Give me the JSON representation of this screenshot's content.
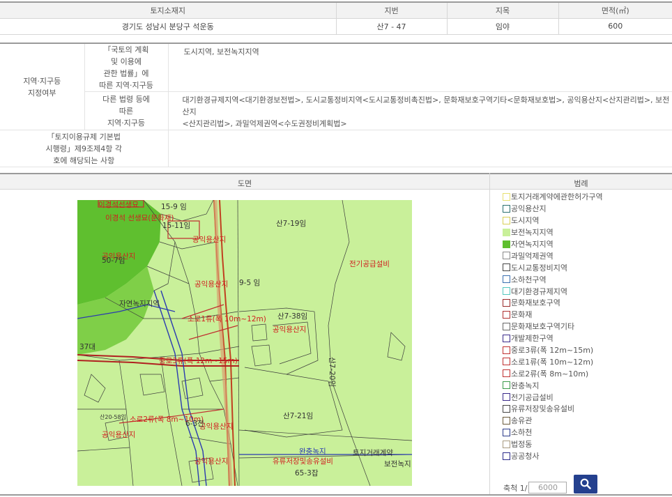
{
  "land_info": {
    "headers": [
      "토지소재지",
      "지번",
      "지목",
      "면적(㎡)"
    ],
    "location": "경기도 성남시 분당구 석운동",
    "lot_number": "산7 - 47",
    "land_category": "임야",
    "area": "600"
  },
  "zoning": {
    "main_label_1": "지역·지구등",
    "main_label_2": "지정여부",
    "national_label": [
      "「국토의 계획",
      "및 이용에",
      "관한 법률」에",
      "따른 지역·지구등"
    ],
    "national_value": "도시지역, 보전녹지지역",
    "other_label": [
      "다른 법령 등에",
      "따른",
      "지역·지구등"
    ],
    "other_value_1": "대기환경규제지역<대기환경보전법>, 도시교통정비지역<도시교통정비촉진법>, 문화재보호구역기타<문화재보호법>, 공익용산지<산지관리법>, 보전산지",
    "other_value_2": "<산지관리법>, 과밀억제권역<수도권정비계획법>",
    "enforcement_label": [
      "「토지이용규제 기본법",
      "시행령」제9조제4항 각",
      "호에 해당되는 사항"
    ],
    "enforcement_value": ""
  },
  "map_section": {
    "map_header": "도면",
    "legend_header": "범례",
    "labels": {
      "l1": "이경석선생묘",
      "l2": "15-9 임",
      "l3": "이경석 선생묘(문화재)",
      "l4": "15-11임",
      "l5": "산7-19임",
      "l6": "공익용산지",
      "l7": "공익용산지",
      "l8": "50-7임",
      "l9": "전기공급설비",
      "l10": "공익용산지",
      "l11": "9-5 임",
      "l12": "자연녹지지역",
      "l13": "소로1류(폭 10m~12m)",
      "l14": "산7-38임",
      "l15": "공익용산지",
      "l16": "산7-20임",
      "l17": "중로3류(폭 12m~15m)",
      "l18": "37대",
      "l19": "소로2류(폭 8m~10m)",
      "l20": "공익용산지",
      "l21": "공익용산지",
      "l22": "산7-21임",
      "l23": "완충녹지",
      "l24": "토지거래계약",
      "l25": "공익용산지",
      "l26": "유류저장및송유설비",
      "l27": "65-3잡",
      "l28": "보전녹지",
      "l29": "6-3전",
      "l30": "산20-58임"
    }
  },
  "legend": [
    {
      "label": "토지거래계약에관한허가구역",
      "fill": "#ffffff",
      "border": "#e8e070"
    },
    {
      "label": "공익용산지",
      "fill": "#ffffff",
      "border": "#2b6f6f"
    },
    {
      "label": "도시지역",
      "fill": "#ffffff",
      "border": "#d9cf55"
    },
    {
      "label": "보전녹지지역",
      "fill": "#c9f09a",
      "border": "#c9f09a"
    },
    {
      "label": "자연녹지지역",
      "fill": "#5fbf2f",
      "border": "#5fbf2f"
    },
    {
      "label": "과밀억제권역",
      "fill": "#ffffff",
      "border": "#8a8a8a"
    },
    {
      "label": "도시교통정비지역",
      "fill": "#ffffff",
      "border": "#444444"
    },
    {
      "label": "소하천구역",
      "fill": "#ffffff",
      "border": "#3a6fb0"
    },
    {
      "label": "대기환경규제지역",
      "fill": "#ffffff",
      "border": "#55c8c0"
    },
    {
      "label": "문화재보호구역",
      "fill": "#ffffff",
      "border": "#9a2a2a"
    },
    {
      "label": "문화재",
      "fill": "#ffffff",
      "border": "#b03030"
    },
    {
      "label": "문화재보호구역기타",
      "fill": "#ffffff",
      "border": "#666666"
    },
    {
      "label": "개발제한구역",
      "fill": "#ffffff",
      "border": "#3a2a8a"
    },
    {
      "label": "중로3류(폭 12m~15m)",
      "fill": "#ffffff",
      "border": "#c03030"
    },
    {
      "label": "소로1류(폭 10m~12m)",
      "fill": "#ffffff",
      "border": "#c03030"
    },
    {
      "label": "소로2류(폭 8m~10m)",
      "fill": "#ffffff",
      "border": "#c03030"
    },
    {
      "label": "완충녹지",
      "fill": "#ffffff",
      "border": "#3a9a4a"
    },
    {
      "label": "전기공급설비",
      "fill": "#ffffff",
      "border": "#3a2a8a"
    },
    {
      "label": "유류저장및송유설비",
      "fill": "#ffffff",
      "border": "#444444"
    },
    {
      "label": "송유관",
      "fill": "#ffffff",
      "border": "#6a5a3a"
    },
    {
      "label": "소하천",
      "fill": "#ffffff",
      "border": "#2a3a8a"
    },
    {
      "label": "법정동",
      "fill": "#ffffff",
      "border": "#a89a80"
    },
    {
      "label": "공공청사",
      "fill": "#ffffff",
      "border": "#2a2a8a"
    }
  ],
  "scale": {
    "label": "축척 1/",
    "value": "6000"
  },
  "icons": {
    "search": "search-icon"
  }
}
